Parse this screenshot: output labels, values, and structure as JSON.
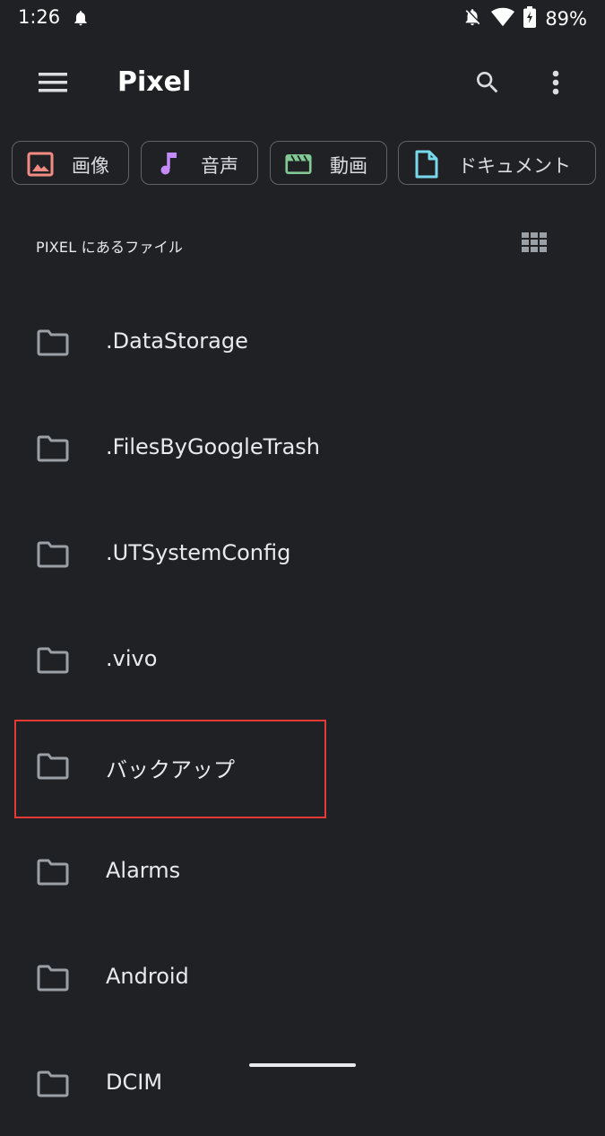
{
  "status_bar": {
    "time": "1:26",
    "battery_text": "89%",
    "icons": [
      "bell-icon",
      "notifications-off-icon",
      "wifi-icon",
      "battery-charging-icon"
    ]
  },
  "toolbar": {
    "title": "Pixel",
    "icons": [
      "menu-icon",
      "search-icon",
      "more-vert-icon"
    ]
  },
  "categories": [
    {
      "label": "画像",
      "icon": "image-icon",
      "color": "#f28b82"
    },
    {
      "label": "音声",
      "icon": "music-note-icon",
      "color": "#c58af9"
    },
    {
      "label": "動画",
      "icon": "movie-icon",
      "color": "#81c995"
    },
    {
      "label": "ドキュメント",
      "icon": "document-icon",
      "color": "#78d9ec"
    }
  ],
  "section": {
    "title": "PIXEL にあるファイル",
    "view_toggle_icon": "grid-view-icon"
  },
  "folders": [
    {
      "name": ".DataStorage"
    },
    {
      "name": ".FilesByGoogleTrash"
    },
    {
      "name": ".UTSystemConfig"
    },
    {
      "name": ".vivo"
    },
    {
      "name": "バックアップ"
    },
    {
      "name": "Alarms"
    },
    {
      "name": "Android"
    },
    {
      "name": "DCIM"
    }
  ],
  "colors": {
    "background": "#202124",
    "text": "#e8eaed",
    "icon": "#9aa0a6",
    "chip_border": "#5f6368",
    "highlight": "#e53935"
  }
}
